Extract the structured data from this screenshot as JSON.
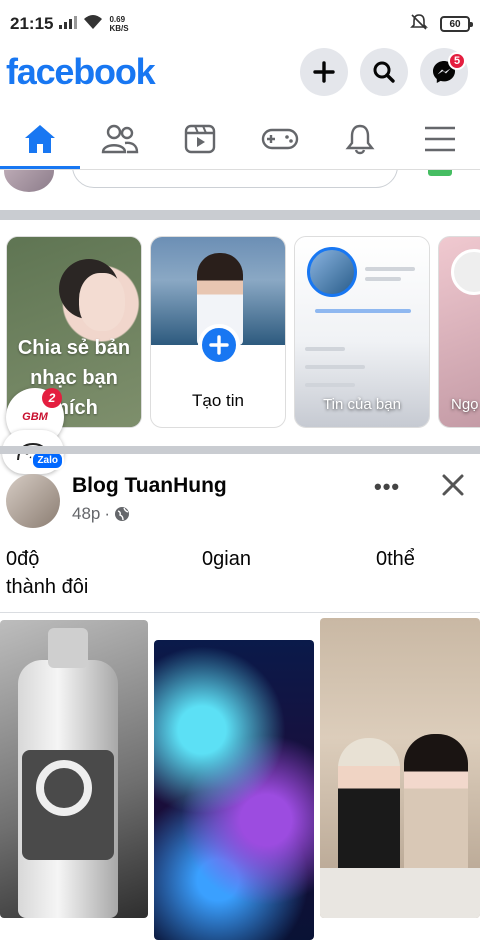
{
  "status_bar": {
    "time": "21:15",
    "speed_value": "0.69",
    "speed_unit": "KB/S",
    "battery": "60"
  },
  "header": {
    "logo": "facebook",
    "messenger_badge": "5"
  },
  "nav": {
    "tabs": [
      {
        "name": "home",
        "active": true
      },
      {
        "name": "friends"
      },
      {
        "name": "watch"
      },
      {
        "name": "gaming"
      },
      {
        "name": "notifications"
      },
      {
        "name": "menu"
      }
    ]
  },
  "stories": {
    "music_label": "Chia sẻ bản nhạc bạn thích",
    "create_label": "Tạo tin",
    "yours_label": "Tin của bạn",
    "next_label": "Ngọ"
  },
  "floating": {
    "gbm_text": "GBM",
    "gbm_badge": "2",
    "zalo_text": "Zalo"
  },
  "post": {
    "author": "Blog TuanHung",
    "time": "48p",
    "separator": "·",
    "text_col1": "0độ",
    "text_col2": "0gian",
    "text_col3": "0thể",
    "text_line2": "thành đôi"
  },
  "colors": {
    "brand": "#1877f2",
    "badge": "#e41e3f"
  }
}
